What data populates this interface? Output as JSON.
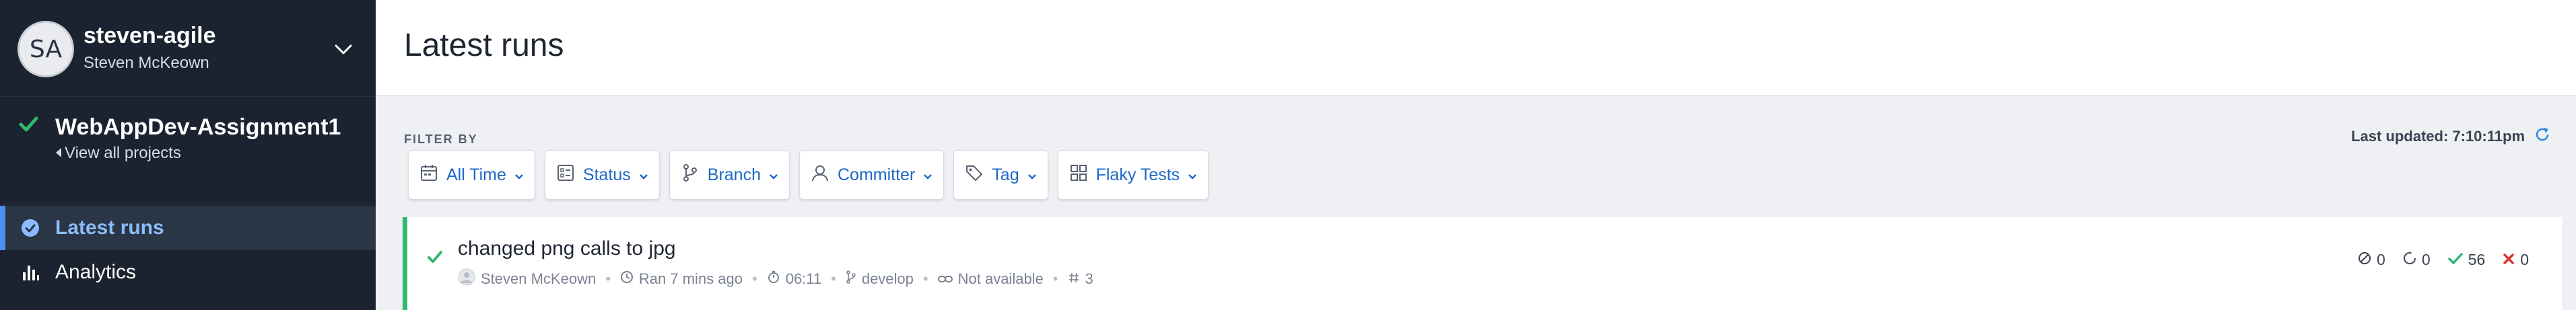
{
  "sidebar": {
    "org": {
      "initials": "SA",
      "name": "steven-agile",
      "user": "Steven McKeown"
    },
    "project": {
      "name": "WebAppDev-Assignment1",
      "view_all": "View all projects"
    },
    "nav": [
      {
        "label": "Latest runs",
        "icon": "check-circle-icon",
        "active": true
      },
      {
        "label": "Analytics",
        "icon": "bar-chart-icon",
        "active": false
      }
    ]
  },
  "main": {
    "title": "Latest runs",
    "filter_label": "FILTER BY",
    "filters": [
      {
        "label": "All Time",
        "icon": "calendar-icon"
      },
      {
        "label": "Status",
        "icon": "status-list-icon"
      },
      {
        "label": "Branch",
        "icon": "branch-icon"
      },
      {
        "label": "Committer",
        "icon": "user-icon"
      },
      {
        "label": "Tag",
        "icon": "tag-icon"
      },
      {
        "label": "Flaky Tests",
        "icon": "grid-icon"
      }
    ],
    "last_updated": "Last updated: 7:10:11pm",
    "runs": [
      {
        "title": "changed png calls to jpg",
        "committer": "Steven McKeown",
        "ran": "Ran 7 mins ago",
        "duration": "06:11",
        "branch": "develop",
        "link": "Not available",
        "number": "3",
        "stats": {
          "skipped": "0",
          "pending": "0",
          "passed": "56",
          "failed": "0"
        }
      }
    ]
  },
  "colors": {
    "sidebar_bg": "#1b2330",
    "accent_blue": "#1d68c7",
    "success_green": "#33b872",
    "fail_red": "#e0322f"
  }
}
